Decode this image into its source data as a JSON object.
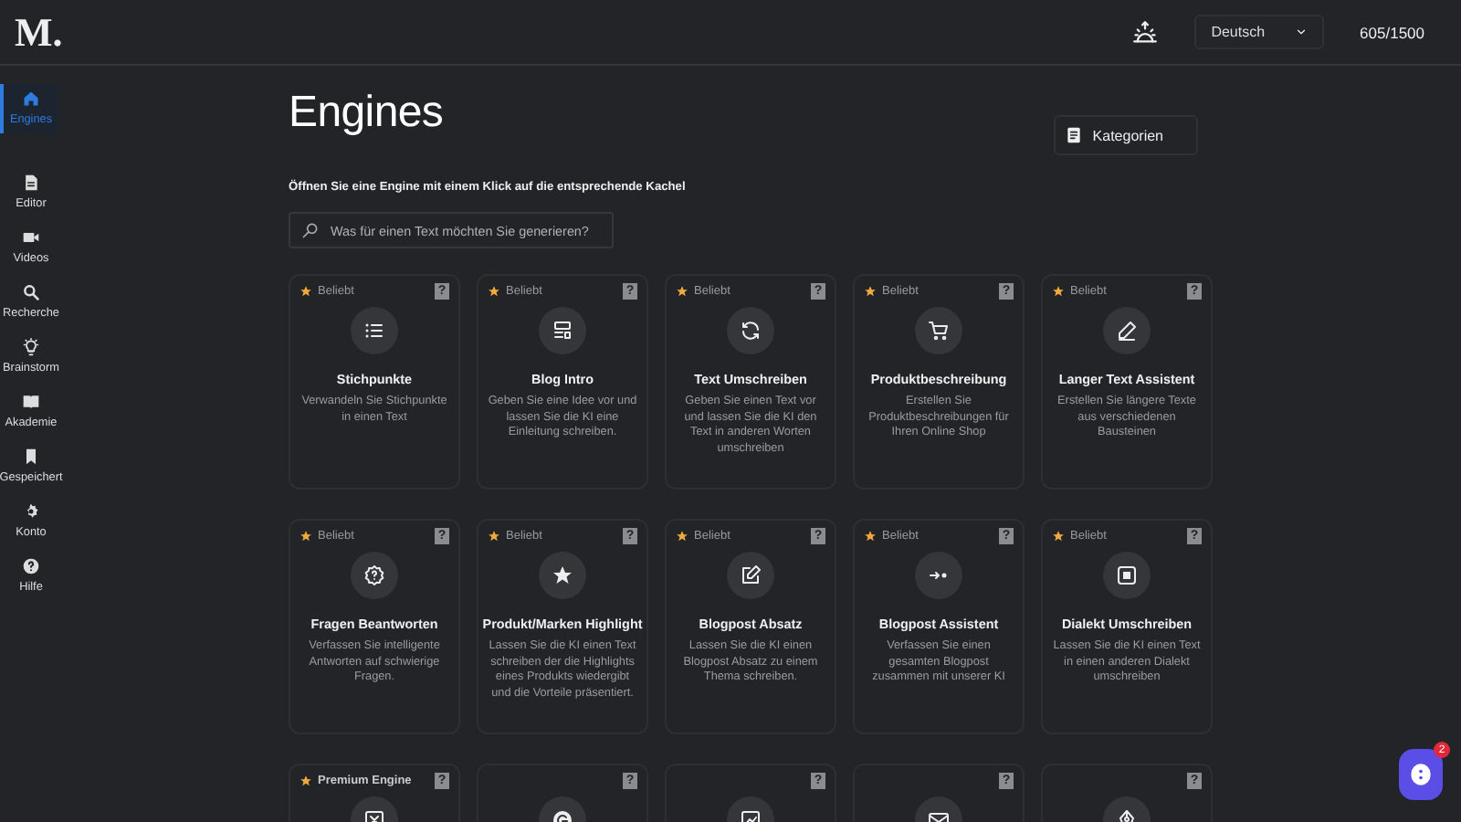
{
  "logo": "M.",
  "top_bar": {
    "language": "Deutsch",
    "credits": "605/1500"
  },
  "sidebar": {
    "items": [
      {
        "label": "Engines",
        "selected": true
      },
      {
        "label": "Editor",
        "selected": false
      },
      {
        "label": "Videos",
        "selected": false
      },
      {
        "label": "Recherche",
        "selected": false
      },
      {
        "label": "Brainstorm",
        "selected": false
      },
      {
        "label": "Akademie",
        "selected": false
      },
      {
        "label": "Gespeichert",
        "selected": false
      },
      {
        "label": "Konto",
        "selected": false
      },
      {
        "label": "Hilfe",
        "selected": false
      }
    ]
  },
  "page": {
    "title": "Engines",
    "subtitle_parts": [
      "Öffnen Sie eine ",
      "Engine",
      " mit einem Klick auf die entsprechende Kachel"
    ],
    "search": {
      "placeholder": "Was für einen Text möchten Sie generieren?"
    },
    "categories_button": "Kategorien"
  },
  "cards": [
    {
      "badge": "Beliebt",
      "help": "?",
      "title": "Stichpunkte",
      "description": "Verwandeln Sie Stichpunkte in einen Text"
    },
    {
      "badge": "Beliebt",
      "help": "?",
      "title": "Blog Intro",
      "description": "Geben Sie eine Idee vor und lassen Sie die KI eine Einleitung schreiben."
    },
    {
      "badge": "Beliebt",
      "help": "?",
      "title": "Text Umschreiben",
      "description": "Geben Sie einen Text vor und lassen Sie die KI den Text in anderen Worten umschreiben"
    },
    {
      "badge": "Beliebt",
      "help": "?",
      "title": "Produktbeschreibung",
      "description": "Erstellen Sie Produktbeschreibungen für Ihren Online Shop"
    },
    {
      "badge": "Beliebt",
      "help": "?",
      "title": "Langer Text Assistent",
      "description": "Erstellen Sie längere Texte aus verschiedenen Bausteinen"
    },
    {
      "badge": "Beliebt",
      "help": "?",
      "title": "Fragen Beantworten",
      "description": "Verfassen Sie intelligente Antworten auf schwierige Fragen."
    },
    {
      "badge": "Beliebt",
      "help": "?",
      "title": "Produkt/Marken Highlight",
      "description": "Lassen Sie die KI einen Text schreiben der die Highlights eines Produkts wiedergibt und die Vorteile präsentiert."
    },
    {
      "badge": "Beliebt",
      "help": "?",
      "title": "Blogpost Absatz",
      "description": "Lassen Sie die KI einen Blogpost Absatz zu einem Thema schreiben."
    },
    {
      "badge": "Beliebt",
      "help": "?",
      "title": "Blogpost Assistent",
      "description": "Verfassen Sie einen gesamten Blogpost zusammen mit unserer KI"
    },
    {
      "badge": "Beliebt",
      "help": "?",
      "title": "Dialekt Umschreiben",
      "description": "Lassen Sie die KI einen Text in einen anderen Dialekt umschreiben"
    },
    {
      "badge": "Premium Engine",
      "help": "?"
    },
    {
      "help": "?"
    },
    {
      "help": "?"
    },
    {
      "help": "?"
    },
    {
      "help": "?"
    }
  ],
  "chat": {
    "unread": "2"
  }
}
